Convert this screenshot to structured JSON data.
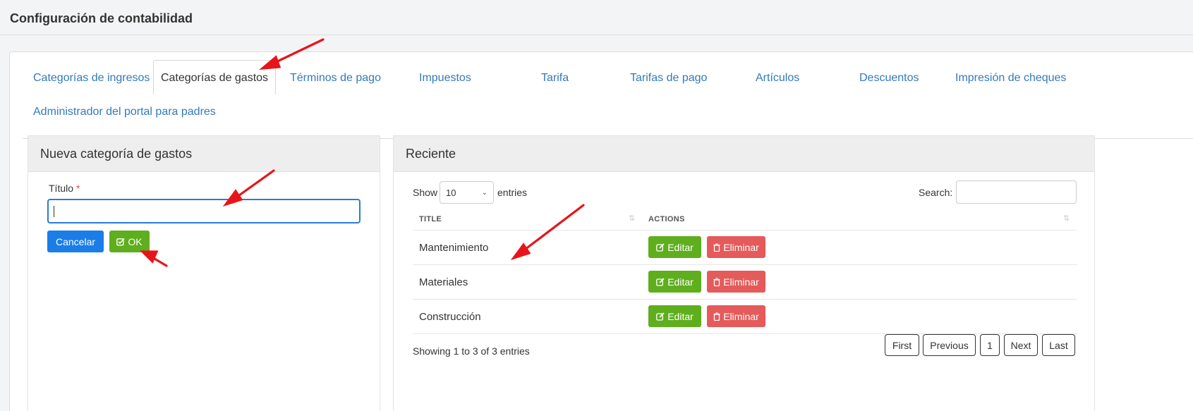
{
  "page": {
    "title": "Configuración de contabilidad"
  },
  "tabs": [
    "Categorías de ingresos",
    "Categorías de gastos",
    "Términos de pago",
    "Impuestos",
    "Tarifa",
    "Tarifas de pago",
    "Artículos",
    "Descuentos",
    "Impresión de cheques",
    "Administrador del portal para padres"
  ],
  "form": {
    "title": "Nueva categoría de gastos",
    "field_label": "Título",
    "required_mark": "*",
    "field_value": "",
    "cancel_label": "Cancelar",
    "ok_label": "OK"
  },
  "recent": {
    "title": "Reciente",
    "show_label": "Show",
    "entries_value": "10",
    "entries_label": "entries",
    "search_label": "Search:",
    "columns": [
      "TITLE",
      "ACTIONS"
    ],
    "rows": [
      {
        "title": "Mantenimiento"
      },
      {
        "title": "Materiales"
      },
      {
        "title": "Construcción"
      }
    ],
    "edit_label": "Editar",
    "delete_label": "Eliminar",
    "info": "Showing 1 to 3 of 3 entries",
    "pagination": [
      "First",
      "Previous",
      "1",
      "Next",
      "Last"
    ]
  },
  "colors": {
    "link": "#337ab7",
    "primary": "#1a7de8",
    "success": "#5fae1e",
    "danger": "#e55a5a",
    "annotation_arrow": "#e8141a"
  }
}
